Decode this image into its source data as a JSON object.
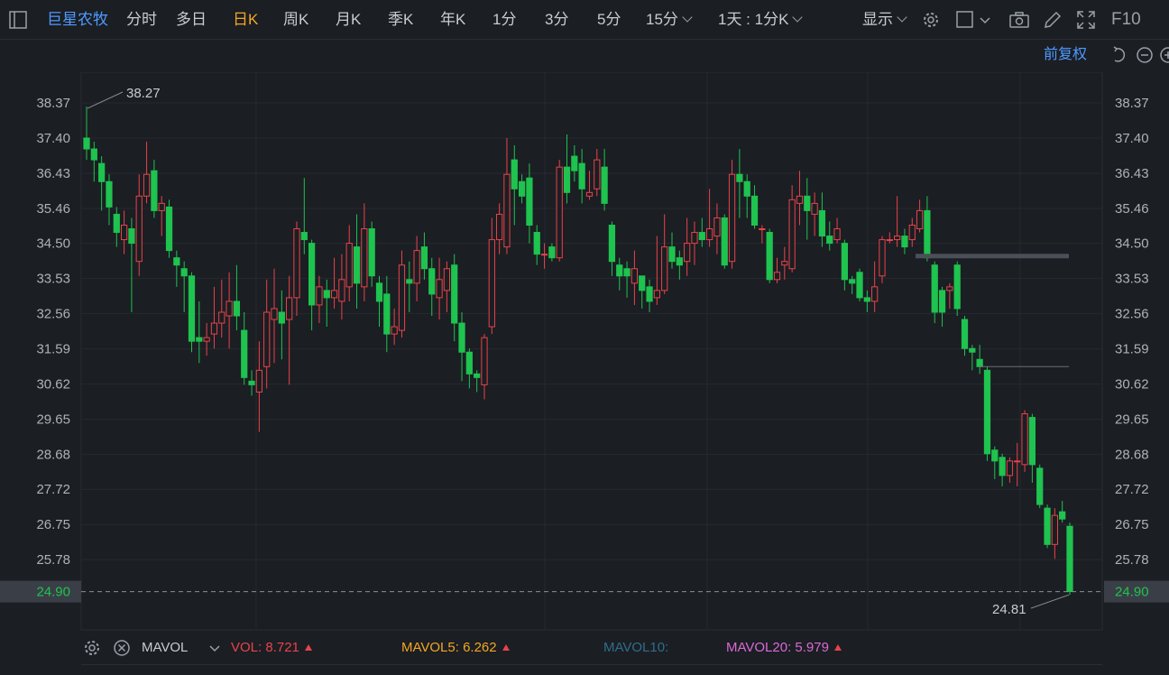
{
  "toolbar": {
    "stock_name": "巨星农牧",
    "periods": [
      "分时",
      "多日",
      "日K",
      "周K",
      "月K",
      "季K",
      "年K",
      "1分",
      "3分",
      "5分",
      "15分"
    ],
    "selected_period": "日K",
    "combo_period": "1天 : 1分K",
    "display_label": "显示",
    "f10_label": "F10"
  },
  "subheader": {
    "adjust_label": "前复权"
  },
  "axis": {
    "y_ticks": [
      "38.37",
      "37.40",
      "36.43",
      "35.46",
      "34.50",
      "33.53",
      "32.56",
      "31.59",
      "30.62",
      "29.65",
      "28.68",
      "27.72",
      "26.75",
      "25.78"
    ],
    "current_price": "24.90",
    "high_label": "38.27",
    "low_label": "24.81"
  },
  "indicator": {
    "name": "MAVOL",
    "vol_label": "VOL: 8.721",
    "mavol5_label": "MAVOL5: 6.262",
    "mavol10_label": "MAVOL10:",
    "mavol20_label": "MAVOL20: 5.979"
  },
  "colors": {
    "up": "#e8434a",
    "down": "#1fc34f",
    "accent": "#f5a623",
    "link": "#4e9bff",
    "background": "#1b1e23"
  },
  "chart_data": {
    "type": "candlestick",
    "ylim": [
      24.3,
      38.9
    ],
    "candles": [
      [
        37.4,
        37.1,
        38.27,
        36.8
      ],
      [
        37.1,
        36.8,
        37.3,
        36.2
      ],
      [
        36.7,
        36.2,
        36.9,
        35.4
      ],
      [
        36.2,
        35.5,
        36.4,
        35.0
      ],
      [
        35.3,
        34.8,
        35.5,
        34.4
      ],
      [
        34.6,
        35.0,
        35.4,
        34.2
      ],
      [
        34.9,
        34.5,
        35.2,
        32.6
      ],
      [
        34.0,
        35.8,
        36.4,
        33.6
      ],
      [
        35.8,
        36.4,
        37.3,
        35.6
      ],
      [
        36.5,
        35.4,
        36.8,
        35.2
      ],
      [
        35.4,
        35.6,
        35.8,
        34.7
      ],
      [
        35.5,
        34.3,
        35.7,
        34.1
      ],
      [
        34.1,
        33.9,
        34.3,
        33.3
      ],
      [
        33.8,
        33.6,
        34.0,
        32.6
      ],
      [
        33.6,
        31.8,
        33.7,
        31.5
      ],
      [
        31.9,
        31.8,
        32.9,
        31.2
      ],
      [
        31.8,
        31.9,
        32.3,
        31.4
      ],
      [
        32.0,
        32.3,
        33.3,
        31.6
      ],
      [
        32.3,
        32.6,
        33.5,
        31.9
      ],
      [
        32.5,
        32.9,
        33.7,
        31.6
      ],
      [
        32.9,
        32.5,
        33.9,
        32.1
      ],
      [
        32.1,
        30.8,
        32.6,
        30.6
      ],
      [
        30.7,
        30.6,
        31.0,
        30.3
      ],
      [
        30.4,
        31.0,
        31.8,
        29.3
      ],
      [
        31.1,
        32.6,
        33.5,
        30.5
      ],
      [
        32.4,
        32.7,
        33.8,
        31.2
      ],
      [
        32.6,
        32.3,
        33.2,
        31.3
      ],
      [
        32.4,
        33.0,
        33.6,
        30.6
      ],
      [
        33.0,
        34.9,
        35.1,
        32.5
      ],
      [
        34.8,
        34.6,
        36.3,
        34.2
      ],
      [
        34.5,
        32.8,
        34.6,
        32.1
      ],
      [
        32.8,
        33.3,
        33.6,
        32.3
      ],
      [
        33.2,
        33.0,
        33.5,
        32.2
      ],
      [
        33.0,
        33.2,
        34.1,
        32.7
      ],
      [
        32.9,
        33.5,
        34.2,
        32.4
      ],
      [
        33.3,
        34.5,
        35.0,
        32.9
      ],
      [
        34.4,
        33.4,
        35.3,
        32.7
      ],
      [
        33.3,
        34.9,
        35.6,
        32.9
      ],
      [
        34.9,
        33.6,
        35.1,
        33.3
      ],
      [
        33.4,
        32.9,
        33.6,
        32.2
      ],
      [
        33.1,
        32.0,
        33.6,
        31.5
      ],
      [
        32.0,
        32.2,
        32.7,
        31.7
      ],
      [
        32.1,
        33.9,
        34.3,
        31.9
      ],
      [
        33.5,
        33.4,
        34.0,
        32.6
      ],
      [
        33.4,
        34.3,
        34.7,
        32.9
      ],
      [
        34.4,
        33.8,
        34.8,
        33.5
      ],
      [
        33.8,
        33.1,
        34.1,
        32.5
      ],
      [
        33.0,
        33.5,
        34.1,
        32.4
      ],
      [
        33.2,
        33.8,
        34.0,
        32.6
      ],
      [
        33.9,
        32.3,
        34.2,
        31.8
      ],
      [
        32.3,
        31.5,
        32.6,
        30.7
      ],
      [
        31.5,
        30.9,
        31.6,
        30.5
      ],
      [
        30.9,
        30.8,
        31.0,
        30.4
      ],
      [
        30.6,
        31.9,
        32.0,
        30.2
      ],
      [
        32.2,
        34.6,
        35.2,
        32.0
      ],
      [
        34.6,
        35.3,
        35.6,
        34.2
      ],
      [
        34.4,
        36.4,
        37.4,
        34.2
      ],
      [
        36.8,
        36.0,
        37.2,
        35.0
      ],
      [
        36.2,
        35.8,
        36.4,
        35.6
      ],
      [
        36.3,
        35.0,
        36.7,
        34.5
      ],
      [
        34.8,
        34.2,
        35.0,
        33.9
      ],
      [
        34.2,
        34.2,
        34.5,
        33.8
      ],
      [
        34.4,
        34.1,
        34.5,
        34.0
      ],
      [
        34.1,
        36.6,
        36.8,
        34.0
      ],
      [
        36.6,
        35.9,
        37.5,
        35.6
      ],
      [
        36.9,
        36.5,
        37.2,
        36.2
      ],
      [
        36.7,
        36.0,
        37.1,
        35.6
      ],
      [
        35.8,
        35.9,
        36.5,
        35.7
      ],
      [
        36.0,
        36.8,
        37.1,
        35.8
      ],
      [
        36.6,
        35.6,
        37.1,
        35.4
      ],
      [
        35.0,
        34.0,
        35.1,
        33.6
      ],
      [
        33.9,
        33.6,
        34.1,
        33.2
      ],
      [
        33.8,
        33.6,
        34.0,
        33.0
      ],
      [
        33.4,
        33.8,
        34.3,
        32.8
      ],
      [
        33.6,
        33.2,
        33.6,
        32.7
      ],
      [
        33.3,
        32.9,
        33.5,
        32.6
      ],
      [
        33.0,
        33.2,
        34.7,
        32.8
      ],
      [
        33.2,
        34.4,
        35.3,
        33.1
      ],
      [
        34.4,
        34.0,
        34.8,
        33.8
      ],
      [
        34.1,
        33.9,
        34.3,
        33.5
      ],
      [
        34.0,
        34.5,
        35.2,
        33.6
      ],
      [
        34.5,
        34.8,
        35.1,
        33.9
      ],
      [
        34.8,
        34.6,
        35.2,
        34.4
      ],
      [
        34.6,
        34.9,
        36.0,
        34.4
      ],
      [
        34.7,
        35.2,
        35.6,
        34.2
      ],
      [
        35.2,
        33.9,
        35.3,
        33.8
      ],
      [
        34.0,
        36.4,
        36.8,
        33.8
      ],
      [
        36.4,
        36.2,
        37.1,
        35.2
      ],
      [
        36.2,
        35.8,
        36.4,
        35.2
      ],
      [
        35.8,
        35.0,
        36.1,
        34.9
      ],
      [
        34.9,
        34.9,
        35.0,
        34.5
      ],
      [
        34.8,
        33.5,
        34.9,
        33.4
      ],
      [
        33.5,
        33.7,
        34.1,
        33.4
      ],
      [
        33.9,
        34.0,
        34.4,
        33.5
      ],
      [
        33.8,
        35.7,
        36.1,
        33.7
      ],
      [
        35.6,
        35.8,
        36.5,
        35.0
      ],
      [
        35.8,
        35.4,
        36.3,
        34.6
      ],
      [
        35.3,
        35.6,
        35.9,
        34.7
      ],
      [
        35.4,
        34.7,
        35.9,
        34.4
      ],
      [
        34.7,
        34.5,
        35.1,
        34.3
      ],
      [
        34.6,
        34.9,
        35.2,
        34.5
      ],
      [
        34.5,
        33.5,
        34.6,
        33.2
      ],
      [
        33.5,
        33.4,
        33.6,
        33.1
      ],
      [
        33.7,
        33.0,
        33.8,
        32.9
      ],
      [
        33.0,
        32.9,
        33.2,
        32.6
      ],
      [
        32.9,
        33.3,
        34.0,
        32.6
      ],
      [
        33.6,
        34.6,
        34.7,
        33.4
      ],
      [
        34.6,
        34.6,
        34.8,
        34.5
      ],
      [
        34.6,
        34.7,
        35.8,
        34.4
      ],
      [
        34.7,
        34.4,
        34.9,
        34.2
      ],
      [
        34.6,
        35.0,
        35.2,
        34.4
      ],
      [
        34.9,
        35.4,
        35.7,
        34.8
      ],
      [
        35.4,
        34.1,
        35.8,
        34.0
      ],
      [
        33.9,
        32.6,
        34.0,
        32.3
      ],
      [
        33.2,
        32.6,
        33.3,
        32.2
      ],
      [
        33.2,
        33.3,
        33.4,
        32.7
      ],
      [
        33.9,
        32.7,
        34.0,
        32.5
      ],
      [
        32.4,
        31.6,
        32.5,
        31.4
      ],
      [
        31.6,
        31.5,
        31.7,
        31.0
      ],
      [
        31.3,
        31.1,
        31.7,
        30.9
      ],
      [
        31.0,
        28.7,
        31.1,
        28.5
      ],
      [
        28.8,
        28.5,
        28.9,
        28.0
      ],
      [
        28.6,
        28.1,
        28.7,
        27.8
      ],
      [
        28.1,
        28.5,
        28.6,
        27.9
      ],
      [
        28.5,
        28.5,
        29.0,
        27.8
      ],
      [
        28.4,
        29.8,
        29.9,
        28.2
      ],
      [
        29.7,
        28.4,
        29.8,
        27.9
      ],
      [
        28.3,
        27.3,
        28.4,
        27.2
      ],
      [
        27.2,
        26.2,
        27.3,
        26.1
      ],
      [
        26.2,
        27.0,
        27.2,
        25.8
      ],
      [
        27.1,
        26.9,
        27.4,
        26.8
      ],
      [
        26.7,
        24.9,
        26.8,
        24.81
      ]
    ]
  }
}
